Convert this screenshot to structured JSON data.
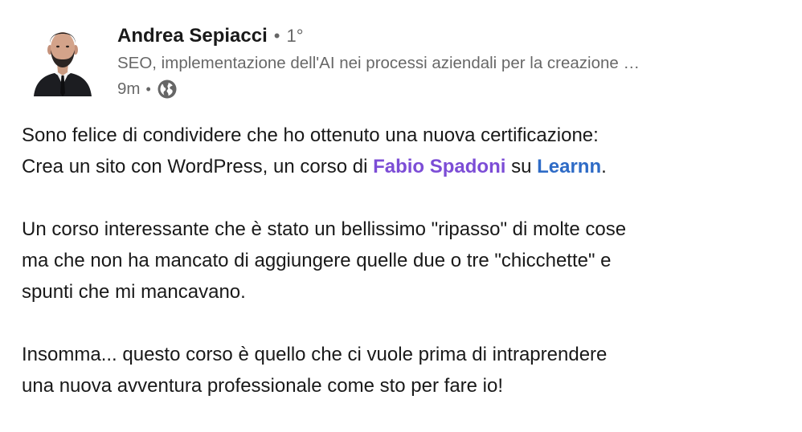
{
  "post": {
    "author": {
      "name": "Andrea Sepiacci",
      "separator": "•",
      "degree": "1°",
      "headline": "SEO, implementazione dell'AI nei processi aziendali per la creazione …",
      "timestamp": "9m",
      "visibility_icon": "globe-icon"
    },
    "body": {
      "p1_line1": "Sono felice di condividere che ho ottenuto una nuova certificazione:",
      "p1_line2_prefix": "Crea un sito con WordPress, un corso di ",
      "mention": "Fabio Spadoni",
      "p1_line2_mid": " su ",
      "company": "Learnn",
      "p1_line2_suffix": ".",
      "p2_line1": "Un corso interessante che è stato un bellissimo \"ripasso\" di molte cose",
      "p2_line2": "ma che non ha mancato di aggiungere quelle due o tre \"chicchette\" e",
      "p2_line3": "spunti che mi mancavano.",
      "p3_line1": "Insomma... questo corso è quello che ci vuole prima di intraprendere",
      "p3_line2": "una nuova avventura professionale come sto per fare io!"
    }
  },
  "colors": {
    "mention": "#7c4dd6",
    "company": "#2e6bc6",
    "text": "#000000e6",
    "muted": "#00000099"
  }
}
